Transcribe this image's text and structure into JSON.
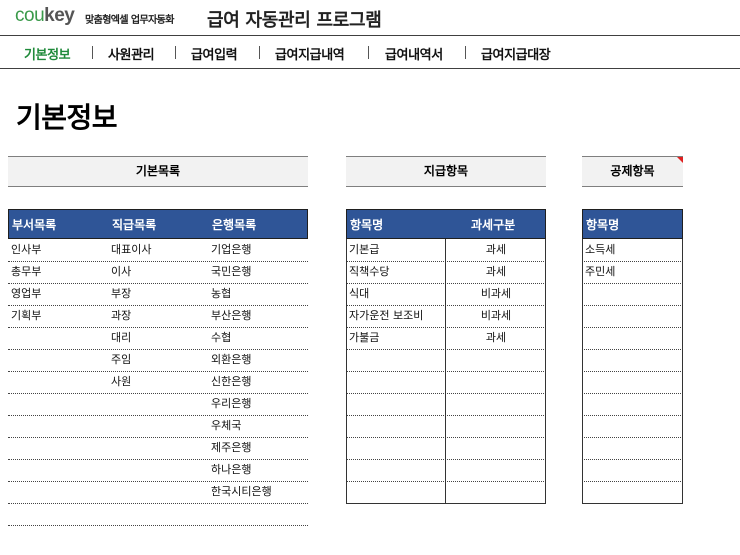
{
  "header": {
    "logo_cou": "cou",
    "logo_key": "key",
    "logo_sub": "맞춤형엑셀 업무자동화",
    "app_title": "급여 자동관리 프로그램"
  },
  "nav": {
    "items": [
      {
        "label": "기본정보",
        "active": true
      },
      {
        "label": "사원관리",
        "active": false
      },
      {
        "label": "급여입력",
        "active": false
      },
      {
        "label": "급여지급내역",
        "active": false
      },
      {
        "label": "급여내역서",
        "active": false
      },
      {
        "label": "급여지급대장",
        "active": false
      }
    ]
  },
  "page_title": "기본정보",
  "basic_list": {
    "section_title": "기본목록",
    "headers": [
      "부서목록",
      "직급목록",
      "은행목록"
    ],
    "departments": [
      "인사부",
      "총무부",
      "영업부",
      "기획부"
    ],
    "positions": [
      "대표이사",
      "이사",
      "부장",
      "과장",
      "대리",
      "주임",
      "사원"
    ],
    "banks": [
      "기업은행",
      "국민은행",
      "농협",
      "부산은행",
      "수협",
      "외환은행",
      "신한은행",
      "우리은행",
      "우체국",
      "제주은행",
      "하나은행",
      "한국시티은행"
    ]
  },
  "pay_items": {
    "section_title": "지급항목",
    "headers": [
      "항목명",
      "과세구분"
    ],
    "rows": [
      {
        "name": "기본급",
        "tax": "과세"
      },
      {
        "name": "직책수당",
        "tax": "과세"
      },
      {
        "name": "식대",
        "tax": "비과세"
      },
      {
        "name": "자가운전 보조비",
        "tax": "비과세"
      },
      {
        "name": "가불금",
        "tax": "과세"
      }
    ]
  },
  "deduction_items": {
    "section_title": "공제항목",
    "headers": [
      "항목명"
    ],
    "rows": [
      "소득세",
      "주민세"
    ]
  },
  "colors": {
    "accent_green": "#1f8a3a",
    "table_header": "#2f5597",
    "comment_marker": "#e02020"
  }
}
